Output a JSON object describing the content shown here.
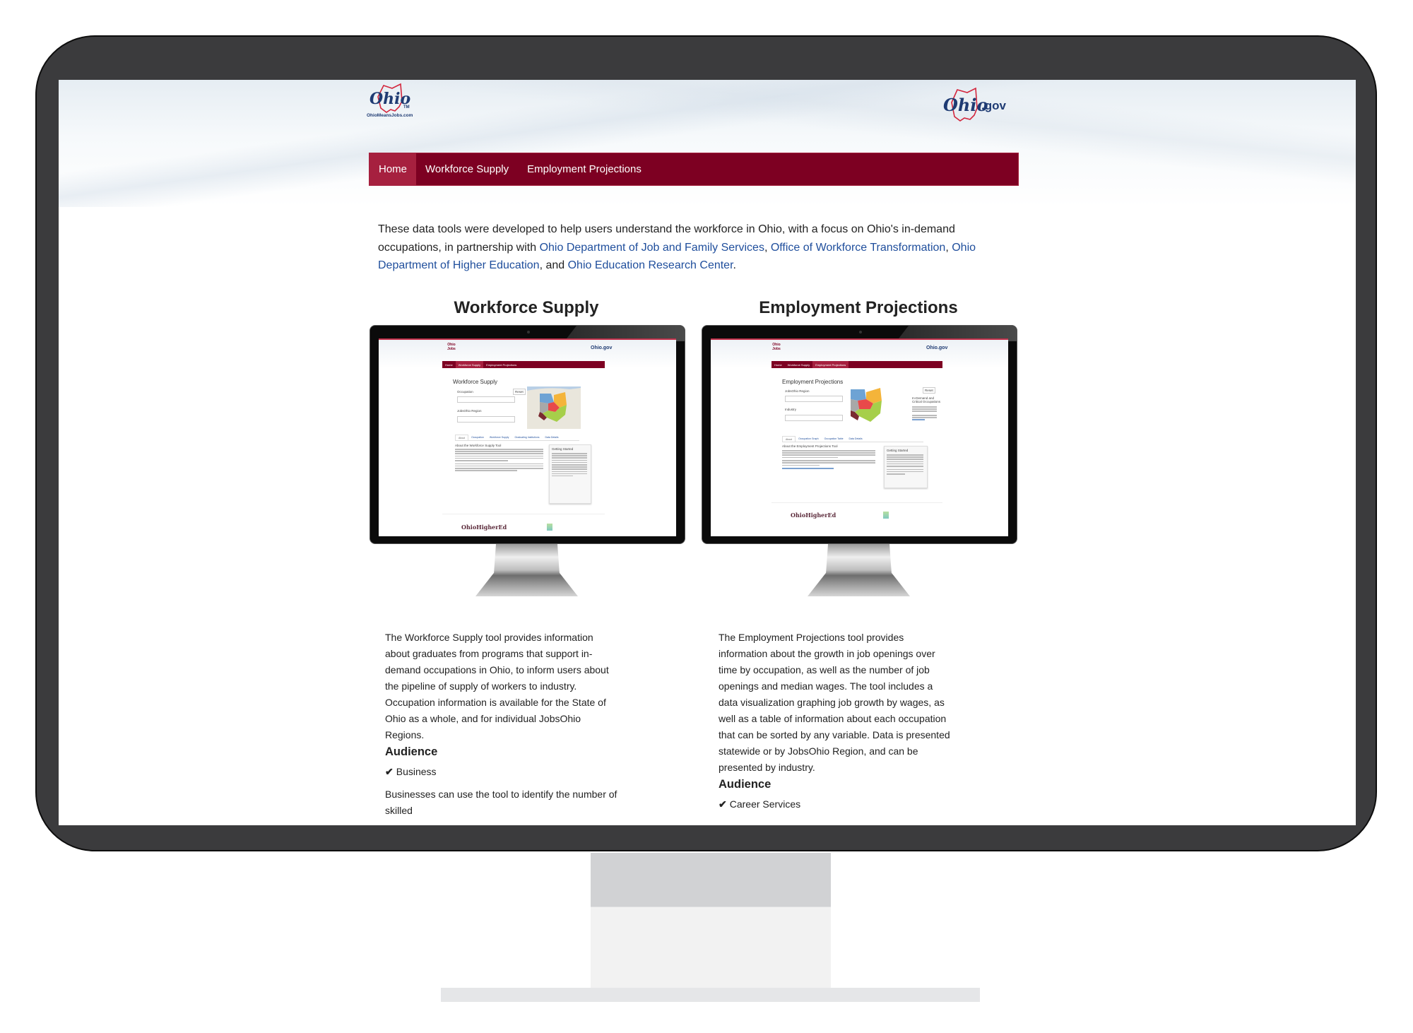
{
  "header": {
    "left_logo": {
      "text": "Ohio",
      "trademark": "TM",
      "caption": "OhioMeansJobs.com"
    },
    "right_logo": {
      "text": "Ohio",
      "suffix": ".gov"
    }
  },
  "nav": {
    "items": [
      {
        "label": "Home",
        "active": true
      },
      {
        "label": "Workforce Supply",
        "active": false
      },
      {
        "label": "Employment Projections",
        "active": false
      }
    ],
    "colors": {
      "bar": "#7d0022",
      "active": "#a6203f"
    }
  },
  "intro": {
    "text_before": "These data tools were developed to help users understand the workforce in Ohio, with a focus on Ohio's in-demand occupations, in partnership with ",
    "links": [
      "Ohio Department of Job and Family Services",
      "Office of Workforce Transformation",
      "Ohio Department of Higher Education",
      "Ohio Education Research Center"
    ],
    "sep1": ", ",
    "sep2": ", ",
    "sep3": ", and ",
    "end": ".",
    "link_color": "#1f4e9c"
  },
  "tools": [
    {
      "title": "Workforce Supply",
      "preview": {
        "nav": [
          "Home",
          "Workforce Supply",
          "Employment Projections"
        ],
        "active_nav": 1,
        "heading": "Workforce Supply",
        "field1_label": "Occupation",
        "field2_label": "JobsOhio Region",
        "reset_label": "Reset",
        "tabs": [
          "About",
          "Occupation",
          "Workforce Supply",
          "Graduating Institutions",
          "Data Details"
        ],
        "section_title": "About the Workforce Supply Tool",
        "card_title": "Getting Started",
        "footer_logo": "OhioHigherEd",
        "gov_logo": "Ohio.gov"
      },
      "description": "The Workforce Supply tool provides information about graduates from programs that support in-demand occupations in Ohio, to inform users about the pipeline of supply of workers to industry. Occupation information is available for the State of Ohio as a whole, and for individual JobsOhio Regions.",
      "audience_heading": "Audience",
      "audience": [
        "Business"
      ],
      "audience_detail": "Businesses can use the tool to identify the number of skilled"
    },
    {
      "title": "Employment Projections",
      "preview": {
        "nav": [
          "Home",
          "Workforce Supply",
          "Employment Projections"
        ],
        "active_nav": 2,
        "heading": "Employment Projections",
        "field1_label": "JobsOhio Region",
        "field2_label": "Industry",
        "reset_label": "Reset",
        "tabs": [
          "About",
          "Occupation Graph",
          "Occupation Table",
          "Data Details"
        ],
        "section_title": "About the Employment Projections Tool",
        "card_title": "Getting Started",
        "radio_title": "In-Demand and Critical Occupations",
        "footer_logo": "OhioHigherEd",
        "gov_logo": "Ohio.gov"
      },
      "description": "The Employment Projections tool provides information about the growth in job openings over time by occupation, as well as the number of job openings and median wages. The tool includes a data visualization graphing job growth by wages, as well as a table of information about each occupation that can be sorted by any variable. Data is presented statewide or by JobsOhio Region, and can be presented by industry.",
      "audience_heading": "Audience",
      "audience": [
        "Career Services"
      ]
    }
  ],
  "map_colors": {
    "northwest": "#6ea3d4",
    "northeast": "#f4b43a",
    "central": "#e84a4a",
    "west": "#a8a8a8",
    "southwest": "#7a2a30",
    "southeast": "#a6cf4a"
  },
  "icons": {
    "check": "✔"
  }
}
